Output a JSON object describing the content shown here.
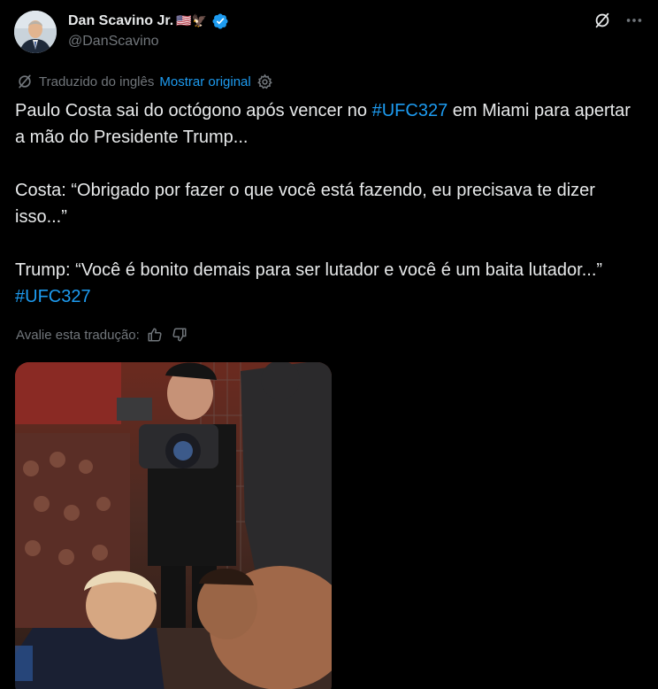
{
  "author": {
    "display_name": "Dan Scavino Jr.",
    "name_emojis": "🇺🇸🦅",
    "handle": "@DanScavino",
    "verified": true,
    "verified_color": "#1d9bf0"
  },
  "header_actions": {
    "grok_icon": "grok-icon",
    "more_icon": "more-icon"
  },
  "translation": {
    "label": "Traduzido do inglês",
    "show_original": "Mostrar original",
    "settings_icon": "gear-icon"
  },
  "tweet": {
    "p1_before": "Paulo Costa sai do octógono após vencer no ",
    "p1_hashtag": "#UFC327",
    "p1_after": " em Miami para apertar a mão do Presidente Trump...",
    "p2": "Costa: “Obrigado por fazer o que você está fazendo, eu precisava te dizer isso...”",
    "p3_before": "Trump: “Você é bonito demais para ser lutador e você é um baita lutador...” ",
    "p3_hashtag": "#UFC327"
  },
  "rate": {
    "label": "Avalie esta tradução:",
    "thumbs_up_icon": "thumbs-up-icon",
    "thumbs_down_icon": "thumbs-down-icon"
  },
  "media": {
    "type": "video-thumbnail"
  },
  "colors": {
    "background": "#000000",
    "text": "#e7e9ea",
    "secondary": "#71767b",
    "accent": "#1d9bf0"
  }
}
